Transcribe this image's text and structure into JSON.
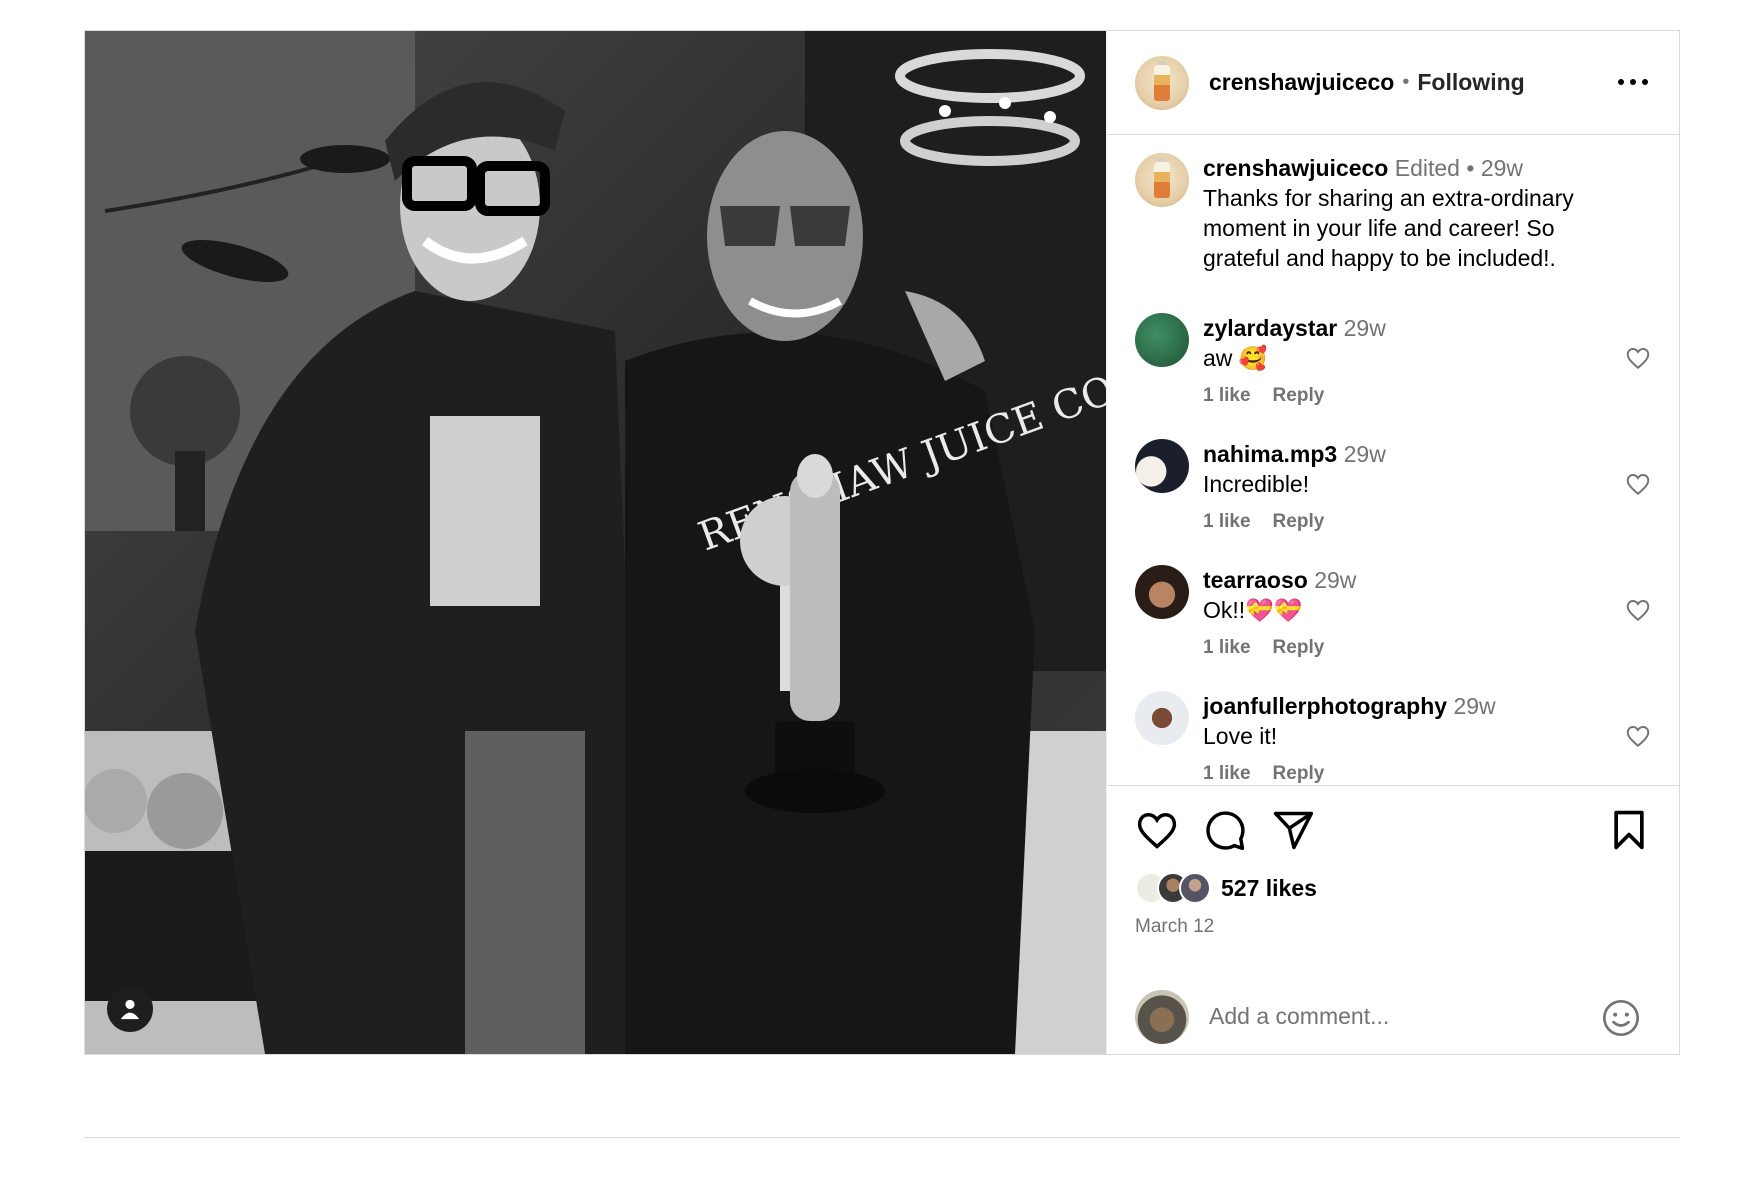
{
  "post": {
    "author": "crenshawjuiceco",
    "separator": "•",
    "follow_state": "Following",
    "more_icon": "more-horizontal-icon"
  },
  "caption": {
    "username": "crenshawjuiceco",
    "edited": "Edited",
    "dot": "•",
    "time": "29w",
    "text": "Thanks for sharing an extra-ordinary moment in your life and career! So grateful and happy to be included!."
  },
  "comments": [
    {
      "username": "zylardaystar",
      "time": "29w",
      "text": "aw 🥰",
      "likes": "1 like",
      "reply": "Reply"
    },
    {
      "username": "nahima.mp3",
      "time": "29w",
      "text": "Incredible!",
      "likes": "1 like",
      "reply": "Reply"
    },
    {
      "username": "tearraoso",
      "time": "29w",
      "text": "Ok!!💝💝",
      "likes": "1 like",
      "reply": "Reply"
    },
    {
      "username": "joanfullerphotography",
      "time": "29w",
      "text": "Love it!",
      "likes": "1 like",
      "reply": "Reply"
    }
  ],
  "actions": {
    "like_icon": "heart-icon",
    "comment_icon": "comment-icon",
    "share_icon": "send-icon",
    "save_icon": "bookmark-icon"
  },
  "likes_text": "527 likes",
  "date": "March 12",
  "comment_box": {
    "placeholder": "Add a comment...",
    "emoji_icon": "smiley-icon"
  },
  "colors": {
    "border": "#dbdbdb",
    "secondary_text": "#737373",
    "primary_text": "#000000"
  }
}
